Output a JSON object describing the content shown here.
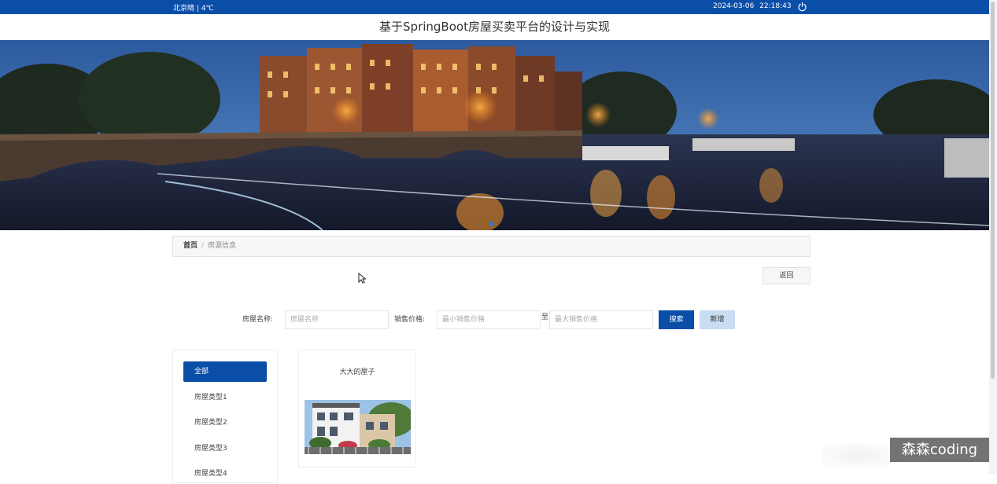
{
  "topbar": {
    "weather": "北京晴 | 4℃",
    "date": "2024-03-06",
    "time": "22:18:43",
    "power_icon": "power-icon",
    "bg_color": "#0b4ea8"
  },
  "site_title": "基于SpringBoot房屋买卖平台的设计与实现",
  "banner": {
    "image": "night-canal-city-photo",
    "indicator_active_color": "#2f7bdc"
  },
  "breadcrumb": {
    "home": "首页",
    "separator": "/",
    "current": "房源信息"
  },
  "back_button": "返回",
  "search": {
    "name_label": "房屋名称:",
    "name_placeholder": "房屋名称",
    "price_label": "销售价格:",
    "min_placeholder": "最小销售价格",
    "to": "至",
    "max_placeholder": "最大销售价格",
    "search_button": "搜索",
    "add_button": "新增"
  },
  "categories": [
    {
      "label": "全部",
      "active": true
    },
    {
      "label": "房屋类型1",
      "active": false
    },
    {
      "label": "房屋类型2",
      "active": false
    },
    {
      "label": "房屋类型3",
      "active": false
    },
    {
      "label": "房屋类型4",
      "active": false
    }
  ],
  "listings": [
    {
      "name": "大大的屋子",
      "image": "house-photo"
    }
  ],
  "watermark": "森森coding",
  "colors": {
    "primary": "#0b4ea8",
    "secondary_button": "#c8dcf2"
  }
}
